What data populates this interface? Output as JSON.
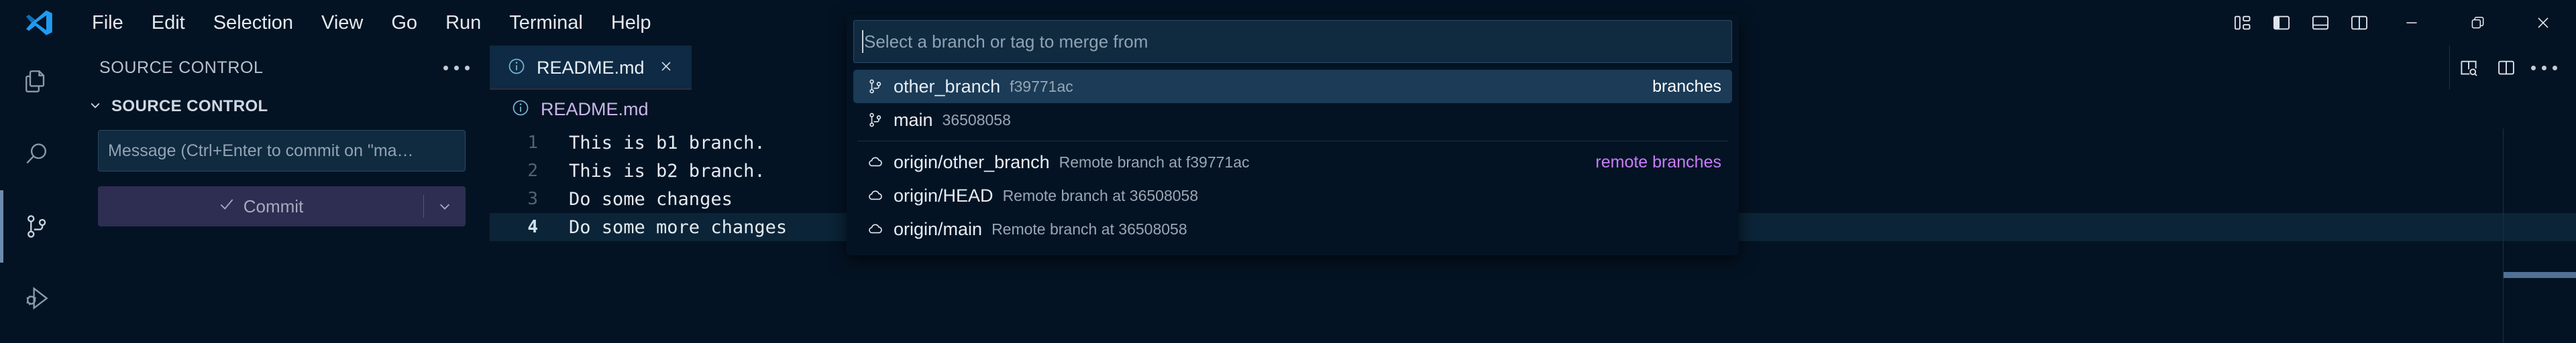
{
  "titlebar": {
    "logo_icon": "vscode-logo-icon",
    "menu": [
      {
        "label": "File"
      },
      {
        "label": "Edit"
      },
      {
        "label": "Selection"
      },
      {
        "label": "View"
      },
      {
        "label": "Go"
      },
      {
        "label": "Run"
      },
      {
        "label": "Terminal"
      },
      {
        "label": "Help"
      }
    ],
    "layout_icons": [
      {
        "name": "customize-layout-icon"
      },
      {
        "name": "toggle-primary-sidebar-icon",
        "active": true
      },
      {
        "name": "toggle-panel-icon"
      },
      {
        "name": "toggle-secondary-sidebar-icon"
      }
    ],
    "window_controls": [
      {
        "name": "minimize-button",
        "glyph": "—"
      },
      {
        "name": "restore-button",
        "glyph": "❐"
      },
      {
        "name": "close-button",
        "glyph": "✕"
      }
    ]
  },
  "activitybar": {
    "items": [
      {
        "name": "explorer",
        "icon": "files-icon",
        "active": false
      },
      {
        "name": "search",
        "icon": "search-icon",
        "active": false
      },
      {
        "name": "source-control",
        "icon": "source-control-icon",
        "active": true
      },
      {
        "name": "run-debug",
        "icon": "run-and-debug-icon",
        "active": false
      }
    ]
  },
  "sidebar": {
    "header_title": "SOURCE CONTROL",
    "more_actions_icon": "ellipsis-icon",
    "section_label": "SOURCE CONTROL",
    "section_chevron": "chevron-down-icon",
    "commit_message_placeholder": "Message (Ctrl+Enter to commit on \"ma…",
    "commit_button_label": "Commit",
    "commit_check_icon": "check-icon",
    "commit_dropdown_icon": "chevron-down-icon"
  },
  "editor": {
    "tab": {
      "label": "README.md",
      "file_icon": "info-file-icon",
      "close_icon": "close-icon"
    },
    "toolbar_icons": [
      {
        "name": "open-preview-to-side-icon"
      },
      {
        "name": "split-editor-icon"
      },
      {
        "name": "more-actions-icon"
      }
    ],
    "breadcrumb": {
      "icon": "info-file-icon",
      "label": "README.md"
    },
    "lines": [
      {
        "number": "1",
        "text": "This is b1 branch.",
        "active": false
      },
      {
        "number": "2",
        "text": "This is b2 branch.",
        "active": false
      },
      {
        "number": "3",
        "text": "Do some changes",
        "active": false
      },
      {
        "number": "4",
        "text": "Do some more changes",
        "active": true
      }
    ]
  },
  "quickpick": {
    "input_placeholder": "Select a branch or tag to merge from",
    "input_value": "",
    "items": [
      {
        "icon": "git-branch-icon",
        "label": "other_branch",
        "description": "f39771ac",
        "group": "branches",
        "group_style": "white",
        "selected": true,
        "separator_after": false
      },
      {
        "icon": "git-branch-icon",
        "label": "main",
        "description": "36508058",
        "group": "",
        "group_style": "",
        "selected": false,
        "separator_after": true
      },
      {
        "icon": "cloud-icon",
        "label": "origin/other_branch",
        "description": "Remote branch at f39771ac",
        "group": "remote branches",
        "group_style": "accent",
        "selected": false,
        "separator_after": false
      },
      {
        "icon": "cloud-icon",
        "label": "origin/HEAD",
        "description": "Remote branch at 36508058",
        "group": "",
        "group_style": "",
        "selected": false,
        "separator_after": false
      },
      {
        "icon": "cloud-icon",
        "label": "origin/main",
        "description": "Remote branch at 36508058",
        "group": "",
        "group_style": "",
        "selected": false,
        "separator_after": false
      }
    ]
  },
  "colors": {
    "background": "#041323",
    "sidebar_bg": "#041323",
    "tab_active_bg": "#0e2a44",
    "input_bg": "#102a40",
    "commit_button_bg": "#2e2d52",
    "quickpick_selected_bg": "#1b3b56",
    "accent_purple": "#c77dff",
    "breadcrumb_text": "#c9b6e8",
    "active_indicator": "#6b8cae"
  }
}
